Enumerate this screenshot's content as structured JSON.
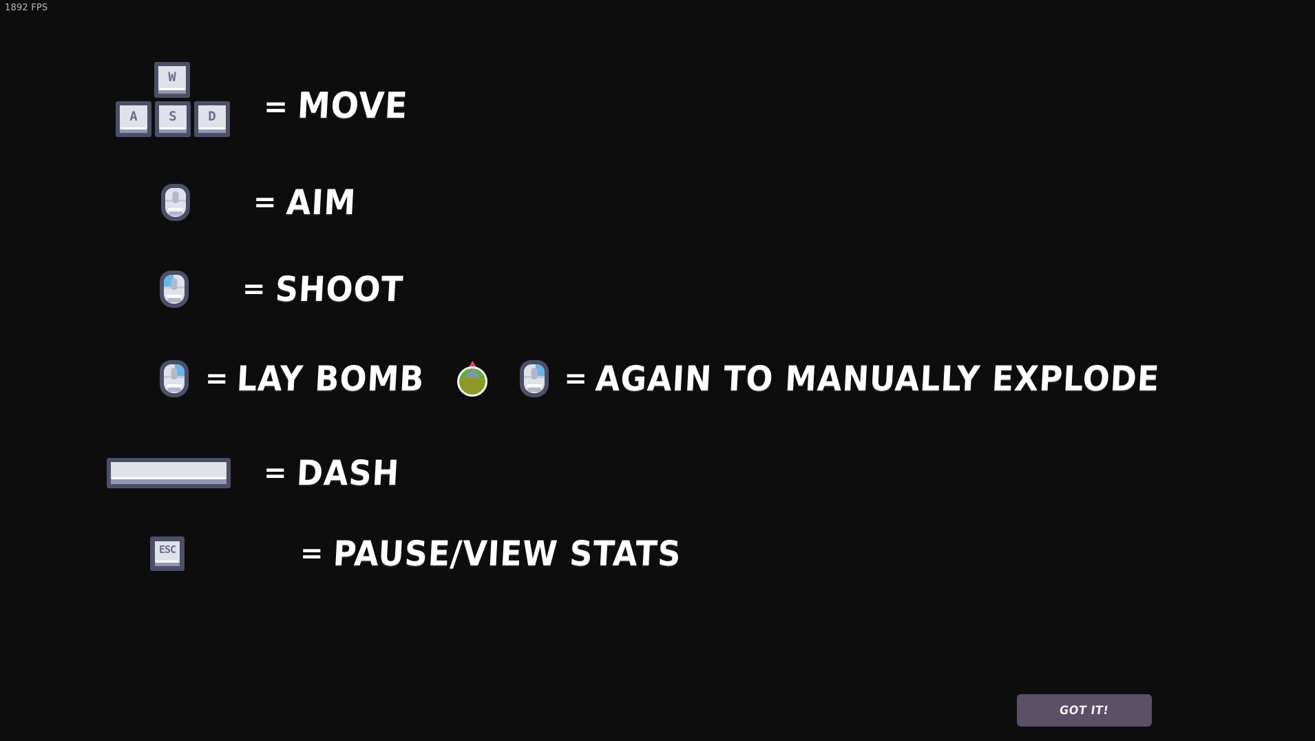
{
  "hud": {
    "fps_label": "1892 FPS"
  },
  "colors": {
    "background": "#0d0d0d",
    "key_border": "#4c4f66",
    "key_face": "#dfe2ea",
    "key_lip": "#9297b4",
    "key_glyph": "#6b6f8c",
    "mouse_highlight": "#67b6e8",
    "text": "#ffffff",
    "button_bg": "#5b5068",
    "button_text": "#efefef",
    "bomb_body": "#8d9a2a",
    "bomb_top": "#5fae3e",
    "bomb_flame": "#e8445e",
    "bomb_cap": "#7d99a8",
    "fps_text": "#b9b9b9"
  },
  "controls": [
    {
      "id": "move",
      "keys": [
        "W",
        "A",
        "S",
        "D"
      ],
      "equals": "=",
      "action": "MOVE"
    },
    {
      "id": "aim",
      "input_icon": "mouse-icon",
      "equals": "=",
      "action": "AIM"
    },
    {
      "id": "shoot",
      "input_icon": "mouse-left-click-icon",
      "equals": "=",
      "action": "SHOOT"
    },
    {
      "id": "bomb",
      "input_icon": "mouse-right-click-icon",
      "equals": "=",
      "action": "LAY BOMB",
      "item_icon": "bomb-icon",
      "second_input_icon": "mouse-right-click-icon",
      "second_equals": "=",
      "second_action": "AGAIN TO MANUALLY EXPLODE"
    },
    {
      "id": "dash",
      "input_icon": "spacebar-key",
      "equals": "=",
      "action": "DASH"
    },
    {
      "id": "pause",
      "keys": [
        "ESC"
      ],
      "equals": "=",
      "action": "PAUSE/VIEW STATS"
    }
  ],
  "button": {
    "confirm_label": "GOT IT!"
  }
}
